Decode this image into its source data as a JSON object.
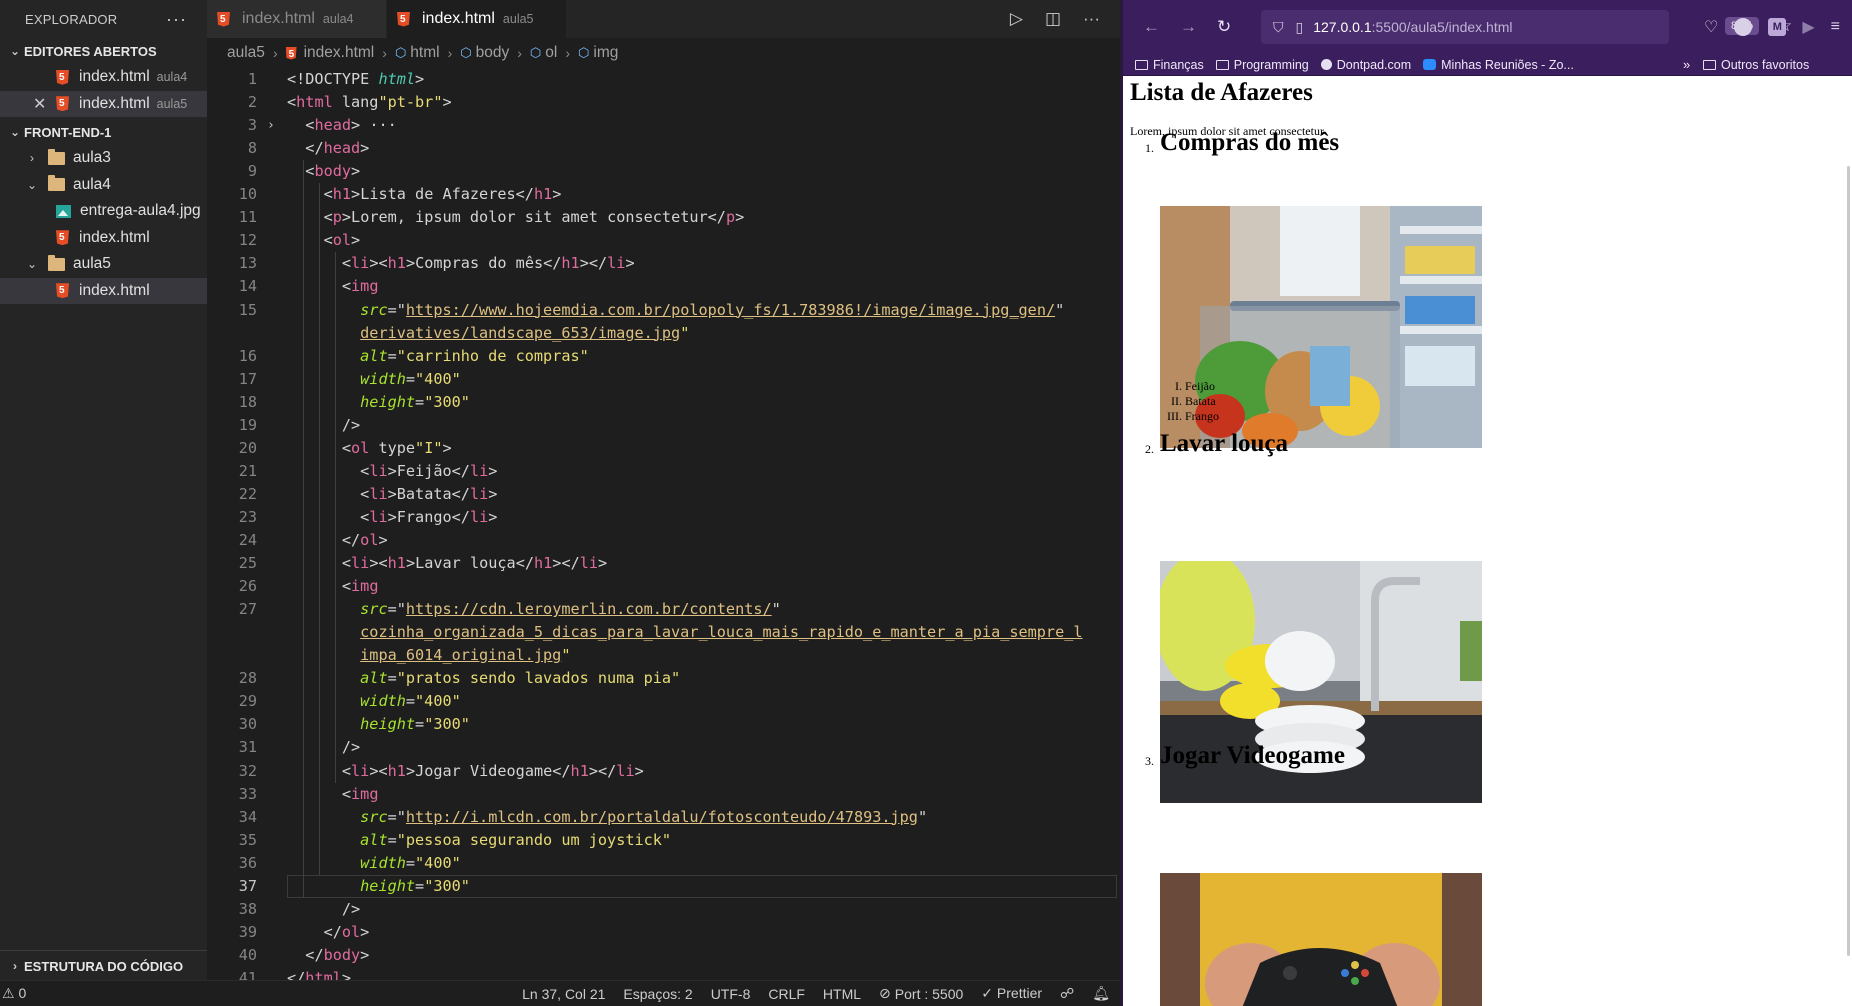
{
  "vscode": {
    "explorer": {
      "title": "EXPLORADOR",
      "more": "···",
      "open_editors_title": "EDITORES ABERTOS",
      "open_editors": [
        {
          "name": "index.html",
          "desc": "aula4"
        },
        {
          "name": "index.html",
          "desc": "aula5",
          "close": "✕"
        }
      ],
      "project_title": "FRONT-END-1",
      "tree": [
        {
          "name": "aula3",
          "type": "folder",
          "state": "collapsed"
        },
        {
          "name": "aula4",
          "type": "folder",
          "state": "expanded"
        },
        {
          "name": "entrega-aula4.jpg",
          "type": "image"
        },
        {
          "name": "index.html",
          "type": "html"
        },
        {
          "name": "aula5",
          "type": "folder",
          "state": "expanded"
        },
        {
          "name": "index.html",
          "type": "html"
        }
      ],
      "outline_title": "ESTRUTURA DO CÓDIGO"
    },
    "tabs": [
      {
        "name": "index.html",
        "desc": "aula4"
      },
      {
        "name": "index.html",
        "desc": "aula5"
      }
    ],
    "tab_actions": {
      "run": "▷",
      "split": "◫",
      "more": "···"
    },
    "breadcrumbs": [
      "aula5",
      "index.html",
      "html",
      "body",
      "ol",
      "img"
    ],
    "code_lines": [
      {
        "n": "1",
        "text": "<!DOCTYPE html>"
      },
      {
        "n": "2",
        "text": "<html lang=\"pt-br\">"
      },
      {
        "n": "3",
        "text": "  <head> ···"
      },
      {
        "n": "8",
        "text": "  </head>"
      },
      {
        "n": "9",
        "text": "  <body>"
      },
      {
        "n": "10",
        "text": "    <h1>Lista de Afazeres</h1>"
      },
      {
        "n": "11",
        "text": "    <p>Lorem, ipsum dolor sit amet consectetur</p>"
      },
      {
        "n": "12",
        "text": "    <ol>"
      },
      {
        "n": "13",
        "text": "      <li><h1>Compras do mês</h1></li>"
      },
      {
        "n": "14",
        "text": "      <img"
      },
      {
        "n": "15",
        "text": "        src=\"https://www.hojeemdia.com.br/polopoly_fs/1.783986!/image/image.jpg_gen/"
      },
      {
        "n": "",
        "text": "        derivatives/landscape_653/image.jpg\""
      },
      {
        "n": "16",
        "text": "        alt=\"carrinho de compras\""
      },
      {
        "n": "17",
        "text": "        width=\"400\""
      },
      {
        "n": "18",
        "text": "        height=\"300\""
      },
      {
        "n": "19",
        "text": "      />"
      },
      {
        "n": "20",
        "text": "      <ol type=\"I\">"
      },
      {
        "n": "21",
        "text": "        <li>Feijão</li>"
      },
      {
        "n": "22",
        "text": "        <li>Batata</li>"
      },
      {
        "n": "23",
        "text": "        <li>Frango</li>"
      },
      {
        "n": "24",
        "text": "      </ol>"
      },
      {
        "n": "25",
        "text": "      <li><h1>Lavar louça</h1></li>"
      },
      {
        "n": "26",
        "text": "      <img"
      },
      {
        "n": "27",
        "text": "        src=\"https://cdn.leroymerlin.com.br/contents/"
      },
      {
        "n": "",
        "text": "        cozinha_organizada_5_dicas_para_lavar_louca_mais_rapido_e_manter_a_pia_sempre_l"
      },
      {
        "n": "",
        "text": "        impa_6014_original.jpg\""
      },
      {
        "n": "28",
        "text": "        alt=\"pratos sendo lavados numa pia\""
      },
      {
        "n": "29",
        "text": "        width=\"400\""
      },
      {
        "n": "30",
        "text": "        height=\"300\""
      },
      {
        "n": "31",
        "text": "      />"
      },
      {
        "n": "32",
        "text": "      <li><h1>Jogar Videogame</h1></li>"
      },
      {
        "n": "33",
        "text": "      <img"
      },
      {
        "n": "34",
        "text": "        src=\"http://i.mlcdn.com.br/portaldalu/fotosconteudo/47893.jpg\""
      },
      {
        "n": "35",
        "text": "        alt=\"pessoa segurando um joystick\""
      },
      {
        "n": "36",
        "text": "        width=\"400\""
      },
      {
        "n": "37",
        "text": "        height=\"300\""
      },
      {
        "n": "38",
        "text": "      />"
      },
      {
        "n": "39",
        "text": "    </ol>"
      },
      {
        "n": "40",
        "text": "  </body>"
      },
      {
        "n": "41",
        "text": "</html>"
      }
    ],
    "status": {
      "problems": "⚠ 0",
      "position": "Ln 37, Col 21",
      "spaces": "Espaços: 2",
      "encoding": "UTF-8",
      "eol": "CRLF",
      "language": "HTML",
      "port": "Port : 5500",
      "prettier": "✓ Prettier"
    }
  },
  "browser": {
    "url_host": "127.0.0.1",
    "url_path": ":5500/aula5/index.html",
    "zoom": "80%",
    "bookmarks": [
      "Finanças",
      "Programming",
      "Dontpad.com",
      "Minhas Reuniões - Zo...",
      "Outros favoritos"
    ],
    "bookmarks_more": "»",
    "page": {
      "h1": "Lista de Afazeres",
      "p": "Lorem, ipsum dolor sit amet consectetur",
      "items": [
        {
          "num": "1.",
          "title": "Compras do mês",
          "alt": "carrinho de compras"
        },
        {
          "num": "2.",
          "title": "Lavar louça",
          "alt": "pratos sendo lavados numa pia"
        },
        {
          "num": "3.",
          "title": "Jogar Videogame",
          "alt": "pessoa segurando um joystick"
        }
      ],
      "sublist": [
        {
          "num": "I.",
          "text": "Feijão"
        },
        {
          "num": "II.",
          "text": "Batata"
        },
        {
          "num": "III.",
          "text": "Frango"
        }
      ]
    }
  },
  "colors": {
    "vscode_bg": "#1e1e1e",
    "sidebar_bg": "#252526",
    "browser_toolbar": "#3b1e5d",
    "html_icon": "#e44d26"
  }
}
